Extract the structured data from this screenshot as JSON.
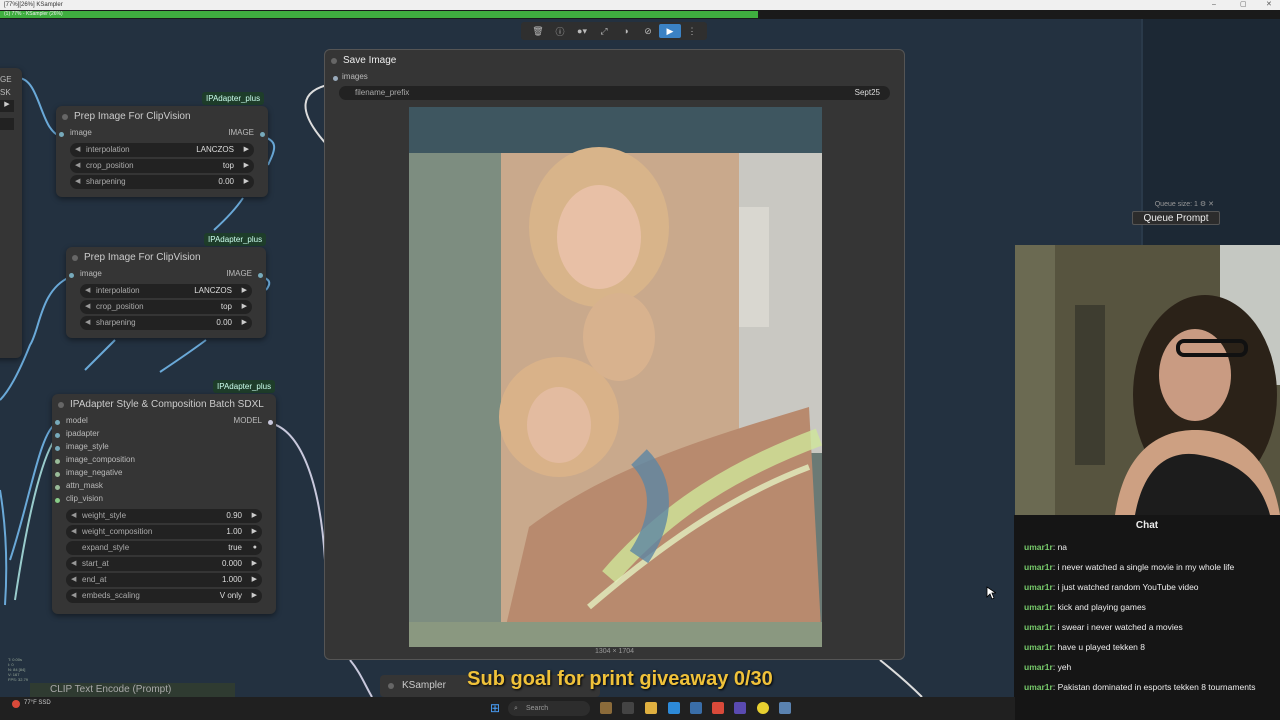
{
  "window": {
    "title": "[77%][26%] KSampler"
  },
  "progress": {
    "label": "(1) 77% - KSampler (26%)",
    "value": 0.77
  },
  "toolbar": {
    "icons": [
      "trash-icon",
      "info-icon",
      "circle-icon",
      "expand-icon",
      "mask-icon",
      "bypass-icon",
      "run-icon",
      "more-icon"
    ]
  },
  "nodes": {
    "prep1": {
      "title": "Prep Image For ClipVision",
      "badge": "IPAdapter_plus",
      "input": "image",
      "output": "IMAGE",
      "widgets": [
        {
          "label": "interpolation",
          "value": "LANCZOS"
        },
        {
          "label": "crop_position",
          "value": "top"
        },
        {
          "label": "sharpening",
          "value": "0.00"
        }
      ]
    },
    "prep2": {
      "title": "Prep Image For ClipVision",
      "badge": "IPAdapter_plus",
      "input": "image",
      "output": "IMAGE",
      "widgets": [
        {
          "label": "interpolation",
          "value": "LANCZOS"
        },
        {
          "label": "crop_position",
          "value": "top"
        },
        {
          "label": "sharpening",
          "value": "0.00"
        }
      ]
    },
    "ipadapter": {
      "title": "IPAdapter Style & Composition Batch SDXL",
      "badge": "IPAdapter_plus",
      "output": "MODEL",
      "inputs": [
        "model",
        "ipadapter",
        "image_style",
        "image_composition",
        "image_negative",
        "attn_mask",
        "clip_vision"
      ],
      "widgets": [
        {
          "label": "weight_style",
          "value": "0.90"
        },
        {
          "label": "weight_composition",
          "value": "1.00"
        },
        {
          "label": "expand_style",
          "value": "true"
        },
        {
          "label": "start_at",
          "value": "0.000"
        },
        {
          "label": "end_at",
          "value": "1.000"
        },
        {
          "label": "embeds_scaling",
          "value": "V only"
        }
      ]
    },
    "save": {
      "title": "Save Image",
      "input": "images",
      "widget": {
        "label": "filename_prefix",
        "value": "Sept25"
      },
      "caption": "1304 × 1704"
    },
    "ksampler": {
      "title": "KSampler"
    },
    "clip": {
      "title": "CLIP Text Encode (Prompt)"
    }
  },
  "left_partial": {
    "labels": [
      "GE",
      "SK"
    ]
  },
  "queue": {
    "size_label": "Queue size: 1",
    "button": "Queue Prompt"
  },
  "chat": {
    "title": "Chat",
    "messages": [
      {
        "user": "umar1r",
        "text": "na"
      },
      {
        "user": "umar1r",
        "text": "i never watched a single movie in my whole life"
      },
      {
        "user": "umar1r",
        "text": "i just watched random YouTube video"
      },
      {
        "user": "umar1r",
        "text": "kick and playing games"
      },
      {
        "user": "umar1r",
        "text": "i swear i never watched a movies"
      },
      {
        "user": "umar1r",
        "text": "have u played tekken 8"
      },
      {
        "user": "umar1r",
        "text": "yeh"
      },
      {
        "user": "umar1r",
        "text": "Pakistan dominated in esports tekken 8 tournaments"
      }
    ]
  },
  "overlay": {
    "subgoal": "Sub goal for print giveaway 0/30"
  },
  "taskbar": {
    "search_placeholder": "Search",
    "weather": "77°F SSD"
  },
  "colors": {
    "canvas": "#233140",
    "node": "#353535",
    "progress": "#3fae3f",
    "chat_user": "#76c96a",
    "subgoal": "#f0c23a"
  }
}
